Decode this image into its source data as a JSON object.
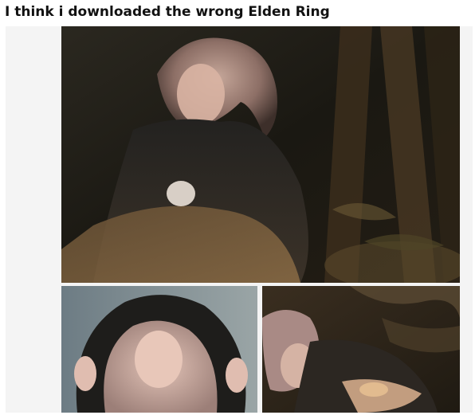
{
  "post": {
    "title": "I think i downloaded the wrong Elden Ring"
  },
  "gallery": {
    "images": [
      {
        "subject": "cosplayer in dark hooded cloak sitting in a night forest",
        "dominant_colors": [
          "#1a1712",
          "#4a3a28",
          "#8a6f5a",
          "#b59a8c"
        ]
      },
      {
        "subject": "cosplayer pulling dark hood over wavy pink-blonde hair",
        "dominant_colors": [
          "#202020",
          "#6b7a82",
          "#c9a89c",
          "#e2c2b8"
        ]
      },
      {
        "subject": "cosplayer lying on the forest floor among ferns",
        "dominant_colors": [
          "#2a2318",
          "#5a4632",
          "#a07a68",
          "#d8b89a"
        ]
      }
    ]
  }
}
